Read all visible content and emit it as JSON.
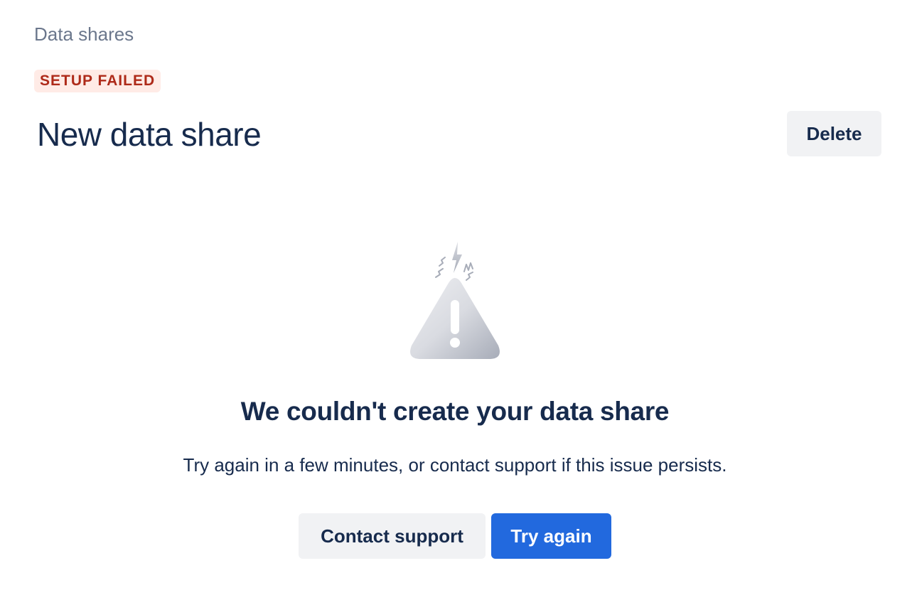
{
  "breadcrumb": {
    "label": "Data shares"
  },
  "status": {
    "label": "SETUP FAILED",
    "color": "#AE2A19",
    "background": "#FFEBE6"
  },
  "header": {
    "title": "New data share",
    "delete_label": "Delete"
  },
  "empty_state": {
    "icon": "warning-triangle-icon",
    "title": "We couldn't create your data share",
    "description": "Try again in a few minutes, or contact support if this issue persists.",
    "secondary_label": "Contact support",
    "primary_label": "Try again"
  },
  "colors": {
    "text": "#172B4D",
    "subtle_text": "#6B778C",
    "primary": "#2269DE",
    "subtle_button": "#F1F2F4"
  }
}
